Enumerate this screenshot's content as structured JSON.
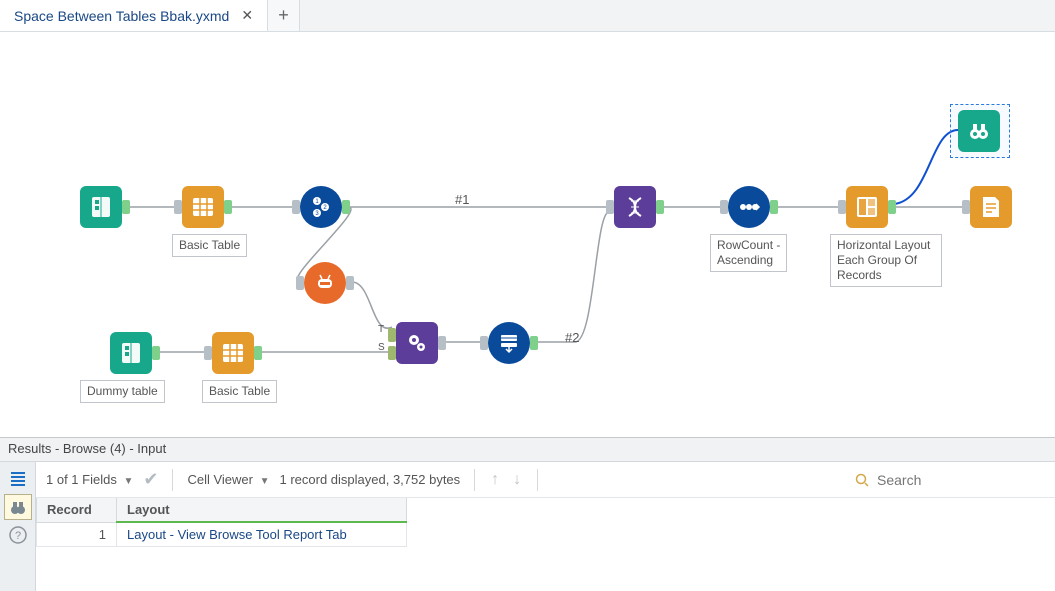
{
  "tabs": {
    "active_label": "Space Between Tables Bbak.yxmd"
  },
  "canvas": {
    "tool_labels": {
      "basic_table_1": "Basic Table",
      "dummy_table": "Dummy table",
      "basic_table_2": "Basic Table",
      "rowcount": "RowCount -\nAscending",
      "hlayout": "Horizontal Layout\nEach Group Of\nRecords"
    },
    "anno_1": "#1",
    "anno_2": "#2"
  },
  "results": {
    "header": "Results - Browse (4) - Input",
    "fields_summary": "1 of 1 Fields",
    "cell_viewer_label": "Cell Viewer",
    "record_summary": "1 record displayed, 3,752 bytes",
    "search_placeholder": "Search",
    "columns": {
      "record": "Record",
      "layout": "Layout"
    },
    "rows": [
      {
        "record": "1",
        "layout": "Layout - View Browse Tool Report Tab"
      }
    ]
  }
}
